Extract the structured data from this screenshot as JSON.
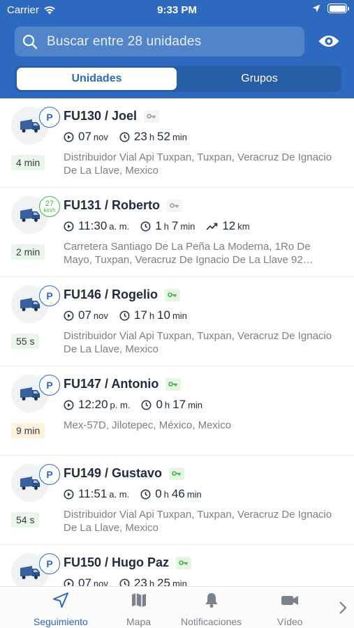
{
  "status_bar": {
    "carrier": "Carrier",
    "time": "9:33 PM"
  },
  "search": {
    "placeholder": "Buscar entre 28 unidades"
  },
  "segments": {
    "active": "Unidades",
    "inactive": "Grupos"
  },
  "units": [
    {
      "name": "FU130 / Joel",
      "badge": "P",
      "ignition": "off",
      "age": "4 min",
      "age_color": "green",
      "time_a": "07",
      "time_a_unit": "nov",
      "time_b": "23",
      "time_b_unit": "h",
      "time_c": "52",
      "time_c_unit": "min",
      "address": "Distribuidor Vial Api Tuxpan, Tuxpan, Veracruz De Ignacio De La Llave, Mexico"
    },
    {
      "name": "FU131 / Roberto",
      "badge_speed": "27",
      "badge_unit": "km/h",
      "ignition": "off",
      "age": "2 min",
      "age_color": "green",
      "time_a": "11:30",
      "time_a_unit": "a. m.",
      "time_b": "1",
      "time_b_unit": "h",
      "time_c": "7",
      "time_c_unit": "min",
      "distance": "12",
      "distance_unit": "km",
      "address": "Carretera Santiago De La Peña La Moderna, 1Ro De Mayo, Tuxpan, Veracruz De Ignacio De La Llave 92…"
    },
    {
      "name": "FU146 / Rogelio",
      "badge": "P",
      "ignition": "on",
      "age": "55 s",
      "age_color": "green",
      "time_a": "07",
      "time_a_unit": "nov",
      "time_b": "17",
      "time_b_unit": "h",
      "time_c": "10",
      "time_c_unit": "min",
      "address": "Distribuidor Vial Api Tuxpan, Tuxpan, Veracruz De Ignacio De La Llave, Mexico"
    },
    {
      "name": "FU147 / Antonio",
      "badge": "P",
      "ignition": "on",
      "age": "9 min",
      "age_color": "orange",
      "time_a": "12:20",
      "time_a_unit": "p. m.",
      "time_b": "0",
      "time_b_unit": "h",
      "time_c": "17",
      "time_c_unit": "min",
      "address": "Mex-57D, Jilotepec, México, Mexico"
    },
    {
      "name": "FU149 / Gustavo",
      "badge": "P",
      "ignition": "on",
      "age": "54 s",
      "age_color": "green",
      "time_a": "11:51",
      "time_a_unit": "a. m.",
      "time_b": "0",
      "time_b_unit": "h",
      "time_c": "46",
      "time_c_unit": "min",
      "address": "Distribuidor Vial Api Tuxpan, Tuxpan, Veracruz De Ignacio De La Llave, Mexico"
    },
    {
      "name": "FU150 / Hugo Paz",
      "badge": "P",
      "ignition": "on",
      "time_a": "07",
      "time_a_unit": "nov",
      "time_b": "23",
      "time_b_unit": "h",
      "time_c": "25",
      "time_c_unit": "min"
    }
  ],
  "tabs": [
    {
      "label": "Seguimiento",
      "icon": "navigation-arrow-icon",
      "active": true
    },
    {
      "label": "Mapa",
      "icon": "map-icon",
      "active": false
    },
    {
      "label": "Notificaciones",
      "icon": "bell-icon",
      "active": false
    },
    {
      "label": "Vídeo",
      "icon": "video-camera-icon",
      "active": false
    }
  ],
  "colors": {
    "brand": "#2d69bf",
    "ignition_on": "#43b14b",
    "text": "#1f2b3d",
    "muted": "#7a808a"
  }
}
